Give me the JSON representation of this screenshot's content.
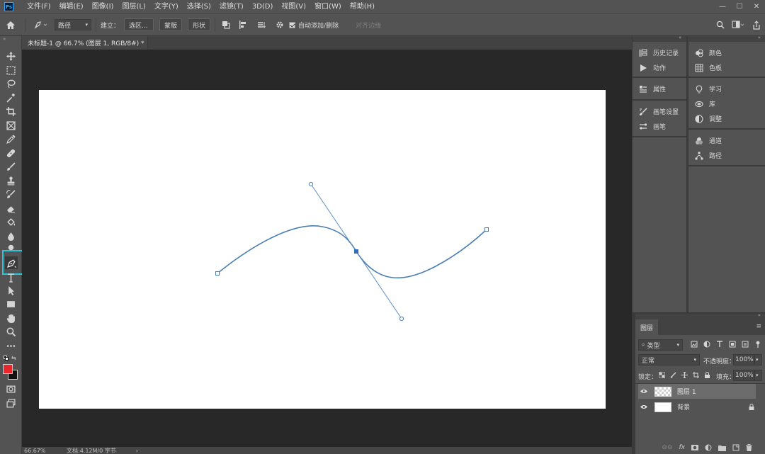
{
  "menubar": {
    "logo": "Ps",
    "items": [
      "文件(F)",
      "编辑(E)",
      "图像(I)",
      "图层(L)",
      "文字(Y)",
      "选择(S)",
      "滤镜(T)",
      "3D(D)",
      "视图(V)",
      "窗口(W)",
      "帮助(H)"
    ]
  },
  "window_controls": {
    "minimize": "—",
    "maximize": "☐",
    "close": "✕"
  },
  "options_bar": {
    "tool_mode": "路径",
    "make_label": "建立：",
    "selection_btn": "选区...",
    "mask_btn": "蒙版",
    "shape_btn": "形状",
    "auto_add_delete": "自动添加/删除",
    "align_edges": "对齐边缘"
  },
  "document": {
    "tab_title": "未标题-1 @ 66.7% (图层 1, RGB/8#) *",
    "zoom": "66.67%",
    "doc_info": "文档:4.12M/0 字节",
    "path_color": "#4a7fb5"
  },
  "panels": {
    "history": "历史记录",
    "actions": "动作",
    "properties": "属性",
    "brush_settings": "画笔设置",
    "brushes": "画笔",
    "color": "颜色",
    "swatches": "色板",
    "learn": "学习",
    "libraries": "库",
    "adjustments": "调整",
    "channels": "通道",
    "paths": "路径"
  },
  "layers_panel": {
    "tab": "图层",
    "filter_kind": "类型",
    "blend_mode": "正常",
    "opacity_label": "不透明度：",
    "opacity_value": "100%",
    "lock_label": "锁定：",
    "fill_label": "填充：",
    "fill_value": "100%",
    "layers": [
      {
        "name": "图层 1",
        "selected": true
      },
      {
        "name": "背景",
        "selected": false,
        "locked": true
      }
    ]
  },
  "colors": {
    "foreground": "#e8262b",
    "background": "#111111",
    "highlight": "#2fc3d6"
  }
}
